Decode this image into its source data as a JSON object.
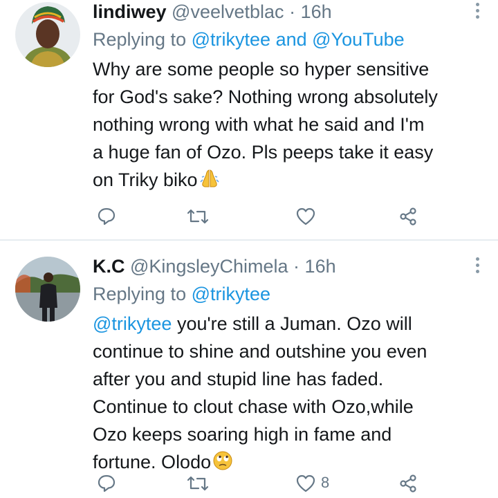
{
  "tweets": [
    {
      "name": "lindiwey",
      "handle": "@veelvetblac",
      "separator": "·",
      "time": "16h",
      "reply_prefix": "Replying to",
      "reply_users": [
        "@trikytee",
        "@YouTube"
      ],
      "reply_joiner": "and",
      "lines": [
        "Why are some people so hyper sensitive",
        "for God's sake? Nothing wrong absolutely",
        "nothing wrong with what he said and I'm",
        "a huge fan of Ozo. Pls peeps take it easy",
        "on Triky biko"
      ],
      "trailing_emoji": "folded-hands-emoji",
      "icons": [
        "reply-icon",
        "retweet-icon",
        "like-icon",
        "share-icon"
      ]
    },
    {
      "name": "K.C",
      "handle": "@KingsleyChimela",
      "separator": "·",
      "time": "16h",
      "reply_prefix": "Replying to",
      "reply_users": [
        "@trikytee"
      ],
      "mention": "@trikytee",
      "lines": [
        " you're still a Juman. Ozo will",
        "continue to shine and outshine you even",
        "after you and stupid line has faded.",
        "Continue to clout chase with Ozo,while",
        "Ozo keeps soaring high in fame and",
        "fortune. Olodo"
      ],
      "trailing_emoji": "eye-roll-emoji",
      "like_count": "8",
      "icons": [
        "reply-icon",
        "retweet-icon",
        "like-icon",
        "share-icon"
      ]
    }
  ],
  "colors": {
    "link": "#1b95e0",
    "secondary_text": "#657786",
    "divider": "#e6ecf0"
  }
}
